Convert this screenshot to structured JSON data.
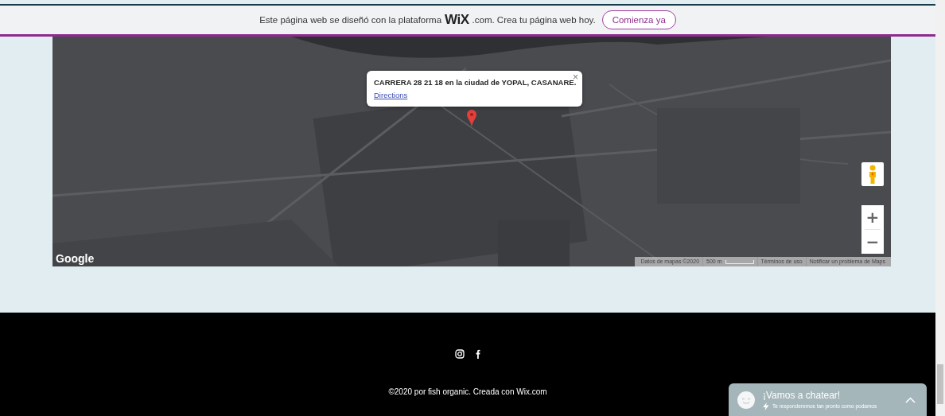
{
  "banner": {
    "text": "Este página web se diseñó con la plataforma",
    "logo": "WiX",
    "logo_suffix": ".com. Crea tu página web hoy.",
    "button": "Comienza ya"
  },
  "map": {
    "kind": "picture",
    "info_window": {
      "title": "CARRERA 28 21 18 en la ciudad de YOPAL, CASANARE.",
      "link": "Directions",
      "close": "×"
    },
    "logo": "Google",
    "attribution": [
      "Datos de mapas ©2020",
      "500 m",
      "Términos de uso",
      "Notificar un problema de Maps"
    ],
    "zoom_in": "+",
    "zoom_out": "−"
  },
  "footer": {
    "copyright": "©2020 por fish organic. Creada con Wix.com"
  },
  "chat": {
    "title": "¡Vamos a chatear!",
    "subtitle": "Te responderemos tan pronto como podamos"
  }
}
